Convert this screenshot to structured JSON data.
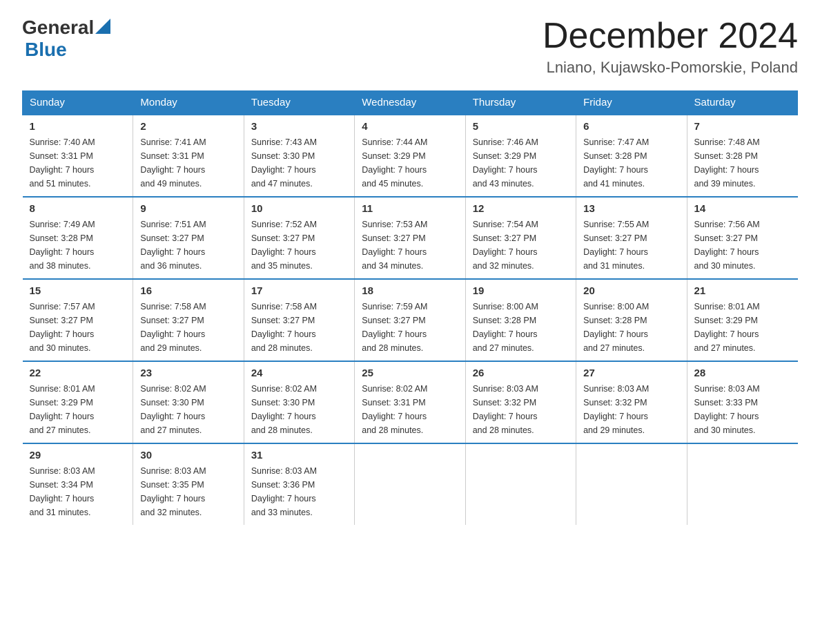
{
  "logo": {
    "text_general": "General",
    "text_blue": "Blue",
    "arrow_shape": "triangle"
  },
  "header": {
    "month_title": "December 2024",
    "location": "Lniano, Kujawsko-Pomorskie, Poland"
  },
  "weekdays": [
    "Sunday",
    "Monday",
    "Tuesday",
    "Wednesday",
    "Thursday",
    "Friday",
    "Saturday"
  ],
  "weeks": [
    [
      {
        "day": "1",
        "sunrise": "7:40 AM",
        "sunset": "3:31 PM",
        "daylight": "7 hours and 51 minutes."
      },
      {
        "day": "2",
        "sunrise": "7:41 AM",
        "sunset": "3:31 PM",
        "daylight": "7 hours and 49 minutes."
      },
      {
        "day": "3",
        "sunrise": "7:43 AM",
        "sunset": "3:30 PM",
        "daylight": "7 hours and 47 minutes."
      },
      {
        "day": "4",
        "sunrise": "7:44 AM",
        "sunset": "3:29 PM",
        "daylight": "7 hours and 45 minutes."
      },
      {
        "day": "5",
        "sunrise": "7:46 AM",
        "sunset": "3:29 PM",
        "daylight": "7 hours and 43 minutes."
      },
      {
        "day": "6",
        "sunrise": "7:47 AM",
        "sunset": "3:28 PM",
        "daylight": "7 hours and 41 minutes."
      },
      {
        "day": "7",
        "sunrise": "7:48 AM",
        "sunset": "3:28 PM",
        "daylight": "7 hours and 39 minutes."
      }
    ],
    [
      {
        "day": "8",
        "sunrise": "7:49 AM",
        "sunset": "3:28 PM",
        "daylight": "7 hours and 38 minutes."
      },
      {
        "day": "9",
        "sunrise": "7:51 AM",
        "sunset": "3:27 PM",
        "daylight": "7 hours and 36 minutes."
      },
      {
        "day": "10",
        "sunrise": "7:52 AM",
        "sunset": "3:27 PM",
        "daylight": "7 hours and 35 minutes."
      },
      {
        "day": "11",
        "sunrise": "7:53 AM",
        "sunset": "3:27 PM",
        "daylight": "7 hours and 34 minutes."
      },
      {
        "day": "12",
        "sunrise": "7:54 AM",
        "sunset": "3:27 PM",
        "daylight": "7 hours and 32 minutes."
      },
      {
        "day": "13",
        "sunrise": "7:55 AM",
        "sunset": "3:27 PM",
        "daylight": "7 hours and 31 minutes."
      },
      {
        "day": "14",
        "sunrise": "7:56 AM",
        "sunset": "3:27 PM",
        "daylight": "7 hours and 30 minutes."
      }
    ],
    [
      {
        "day": "15",
        "sunrise": "7:57 AM",
        "sunset": "3:27 PM",
        "daylight": "7 hours and 30 minutes."
      },
      {
        "day": "16",
        "sunrise": "7:58 AM",
        "sunset": "3:27 PM",
        "daylight": "7 hours and 29 minutes."
      },
      {
        "day": "17",
        "sunrise": "7:58 AM",
        "sunset": "3:27 PM",
        "daylight": "7 hours and 28 minutes."
      },
      {
        "day": "18",
        "sunrise": "7:59 AM",
        "sunset": "3:27 PM",
        "daylight": "7 hours and 28 minutes."
      },
      {
        "day": "19",
        "sunrise": "8:00 AM",
        "sunset": "3:28 PM",
        "daylight": "7 hours and 27 minutes."
      },
      {
        "day": "20",
        "sunrise": "8:00 AM",
        "sunset": "3:28 PM",
        "daylight": "7 hours and 27 minutes."
      },
      {
        "day": "21",
        "sunrise": "8:01 AM",
        "sunset": "3:29 PM",
        "daylight": "7 hours and 27 minutes."
      }
    ],
    [
      {
        "day": "22",
        "sunrise": "8:01 AM",
        "sunset": "3:29 PM",
        "daylight": "7 hours and 27 minutes."
      },
      {
        "day": "23",
        "sunrise": "8:02 AM",
        "sunset": "3:30 PM",
        "daylight": "7 hours and 27 minutes."
      },
      {
        "day": "24",
        "sunrise": "8:02 AM",
        "sunset": "3:30 PM",
        "daylight": "7 hours and 28 minutes."
      },
      {
        "day": "25",
        "sunrise": "8:02 AM",
        "sunset": "3:31 PM",
        "daylight": "7 hours and 28 minutes."
      },
      {
        "day": "26",
        "sunrise": "8:03 AM",
        "sunset": "3:32 PM",
        "daylight": "7 hours and 28 minutes."
      },
      {
        "day": "27",
        "sunrise": "8:03 AM",
        "sunset": "3:32 PM",
        "daylight": "7 hours and 29 minutes."
      },
      {
        "day": "28",
        "sunrise": "8:03 AM",
        "sunset": "3:33 PM",
        "daylight": "7 hours and 30 minutes."
      }
    ],
    [
      {
        "day": "29",
        "sunrise": "8:03 AM",
        "sunset": "3:34 PM",
        "daylight": "7 hours and 31 minutes."
      },
      {
        "day": "30",
        "sunrise": "8:03 AM",
        "sunset": "3:35 PM",
        "daylight": "7 hours and 32 minutes."
      },
      {
        "day": "31",
        "sunrise": "8:03 AM",
        "sunset": "3:36 PM",
        "daylight": "7 hours and 33 minutes."
      },
      null,
      null,
      null,
      null
    ]
  ],
  "labels": {
    "sunrise": "Sunrise:",
    "sunset": "Sunset:",
    "daylight": "Daylight:"
  }
}
